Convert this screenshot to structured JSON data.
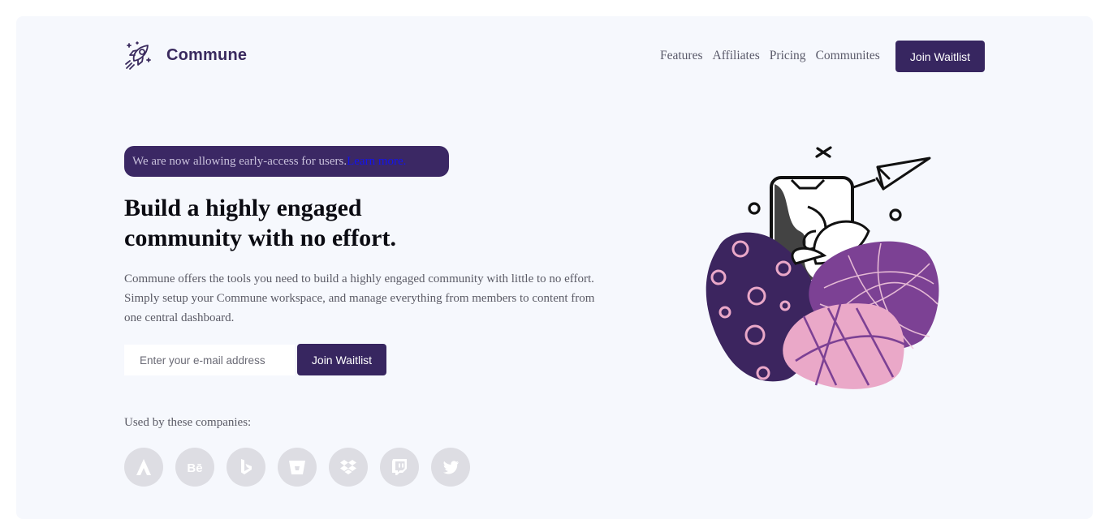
{
  "brand": {
    "name": "Commune",
    "logo_icon": "rocket-icon"
  },
  "nav": {
    "links": [
      "Features",
      "Affiliates",
      "Pricing",
      "Communites"
    ],
    "cta_label": "Join Waitlist"
  },
  "hero": {
    "announcement": "We are now allowing early-access for users.",
    "announcement_link": "Learn more.",
    "headline": "Build a highly engaged community with no effort.",
    "description": "Commune offers the tools you need to build a highly engaged community with little to no effort. Simply setup your Commune workspace, and manage everything from members to content from one central dashboard.",
    "email_placeholder": "Enter your e-mail address",
    "cta_label": "Join Waitlist"
  },
  "companies": {
    "label": "Used by these companies:",
    "logos": [
      "atlassian-icon",
      "behance-icon",
      "bing-icon",
      "bitbucket-icon",
      "dropbox-icon",
      "twitch-icon",
      "twitter-icon"
    ]
  },
  "colors": {
    "brand_purple": "#372660",
    "pill_bg": "#3b2864",
    "panel_bg": "#f6f8fd",
    "pink": "#eaa8c8",
    "mauve": "#7c4194",
    "logo_gray": "#dddde3"
  }
}
